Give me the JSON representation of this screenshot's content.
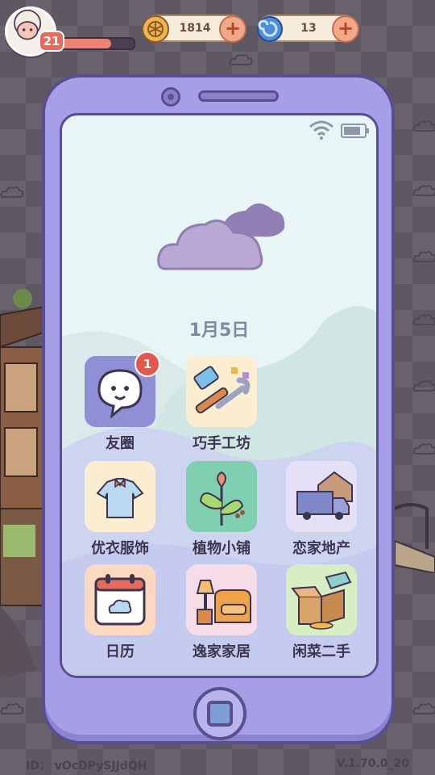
{
  "hud": {
    "level": "21",
    "xp_fraction": 0.7,
    "coins": "1814",
    "gems": "13",
    "coin_icon": "coin-icon",
    "gem_icon": "swirl-gem-icon",
    "plus": "+"
  },
  "phone": {
    "date": "1月5日",
    "weather_icon": "cloud-icon",
    "status_icons": [
      "wifi-icon",
      "battery-icon"
    ],
    "apps": [
      {
        "label": "友圈",
        "icon": "chat-bubble-icon",
        "badge": "1"
      },
      {
        "label": "巧手工坊",
        "icon": "brush-wrench-icon"
      },
      {
        "label": "优衣服饰",
        "icon": "shirt-icon"
      },
      {
        "label": "植物小铺",
        "icon": "plant-icon"
      },
      {
        "label": "恋家地产",
        "icon": "moving-truck-icon"
      },
      {
        "label": "日历",
        "icon": "calendar-icon"
      },
      {
        "label": "逸家家居",
        "icon": "sofa-icon"
      },
      {
        "label": "闲菜二手",
        "icon": "box-tag-icon"
      }
    ]
  },
  "footer": {
    "id": "ID： vOcDPySJJdQH",
    "version": "V.1.70.0_20"
  },
  "colors": {
    "phone_body": "#a79ee8",
    "outline": "#5a4e8e",
    "screen": "#e8f5f5",
    "badge": "#e4584c"
  }
}
